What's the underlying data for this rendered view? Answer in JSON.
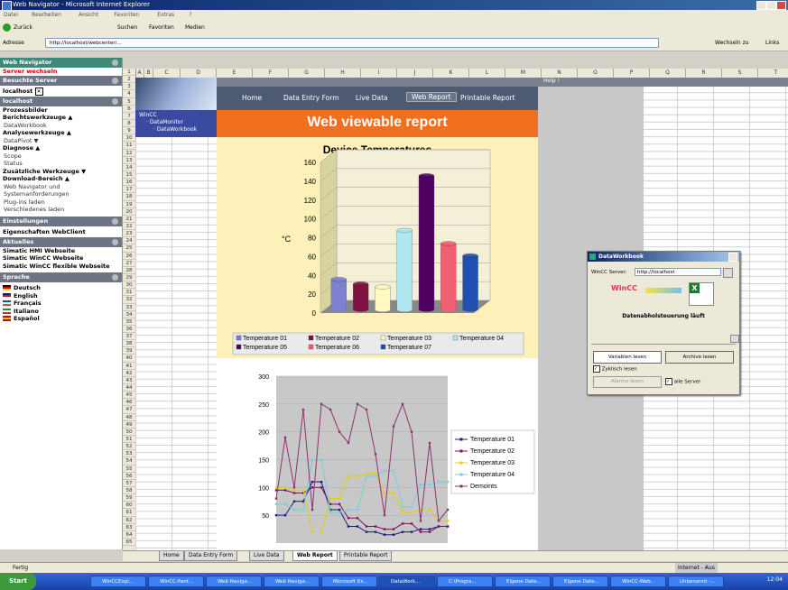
{
  "window": {
    "title": "Web Navigator - Microsoft Internet Explorer"
  },
  "menu": [
    "Datei",
    "Bearbeiten",
    "Ansicht",
    "Favoriten",
    "Extras",
    "?"
  ],
  "toolbar": {
    "back": "Zurück",
    "search": "Suchen",
    "favorites": "Favoriten",
    "media": "Medien"
  },
  "address": {
    "label": "Adresse",
    "url": "http://localhost/webcenter/...",
    "go": "Wechseln zu",
    "links": "Links"
  },
  "sidebar": {
    "title": "Web Navigator",
    "server_switch": "Server wechseln",
    "visited_label": "Besuchte Server",
    "visited_value": "localhost",
    "localhost_label": "localhost",
    "items": [
      {
        "label": "Prozessbilder",
        "bold": true
      },
      {
        "label": "Berichtswerkzeuge ▲",
        "bold": true
      },
      {
        "label": "DataWorkbook",
        "bold": false
      },
      {
        "label": "Analysewerkzeuge ▲",
        "bold": true
      },
      {
        "label": "DataPivot ▼",
        "bold": false
      },
      {
        "label": "Diagnose ▲",
        "bold": true
      },
      {
        "label": "Scope",
        "bold": false
      },
      {
        "label": "Status",
        "bold": false
      },
      {
        "label": "Zusätzliche Werkzeuge ▼",
        "bold": true
      },
      {
        "label": "Download-Bereich ▲",
        "bold": true
      },
      {
        "label": "Web Navigator und",
        "bold": false
      },
      {
        "label": "Systemanforderungen",
        "bold": false
      },
      {
        "label": "Plug-ins laden",
        "bold": false
      },
      {
        "label": "Verschiedenes laden",
        "bold": false
      }
    ],
    "settings_label": "Einstellungen",
    "settings_item": "Eigenschaften WebClient",
    "news_label": "Aktuelles",
    "news_items": [
      "Simatic HMI Webseite",
      "Simatic WinCC Webseite",
      "Simatic WinCC flexible Webseite"
    ],
    "lang_label": "Sprache",
    "languages": [
      {
        "label": "Deutsch",
        "c1": "#000000",
        "c2": "#dd0000",
        "c3": "#ffcc00"
      },
      {
        "label": "English",
        "c1": "#012169",
        "c2": "#c8102e",
        "c3": "#ffffff"
      },
      {
        "label": "Français",
        "c1": "#0055a4",
        "c2": "#ffffff",
        "c3": "#ef4135"
      },
      {
        "label": "Italiano",
        "c1": "#009246",
        "c2": "#ffffff",
        "c3": "#ce2b37"
      },
      {
        "label": "Español",
        "c1": "#aa151b",
        "c2": "#f1bf00",
        "c3": "#aa151b"
      }
    ]
  },
  "sheet": {
    "columns": [
      "A",
      "B",
      "C",
      "D",
      "E",
      "F",
      "G",
      "H",
      "I",
      "J",
      "K",
      "L",
      "M",
      "N",
      "O",
      "P",
      "Q",
      "R",
      "S",
      "T"
    ],
    "nav": [
      "Home",
      "Data Entry Form",
      "Live Data",
      "Web Report",
      "Printable Report"
    ],
    "help": "Help !",
    "wincc_links": [
      "WinCC",
      "DataMonitor",
      "DataWorkbook"
    ],
    "report_title": "Web viewable report",
    "tabs": [
      "Home",
      "Data Entry Form",
      "Live Data",
      "Web Report",
      "Printable Report"
    ]
  },
  "chart_data": [
    {
      "type": "bar",
      "title": "Device Temperatures",
      "ylabel": "°C",
      "ylim": [
        0,
        160
      ],
      "yticks": [
        0,
        20,
        40,
        60,
        80,
        100,
        120,
        140,
        160
      ],
      "categories": [
        "Temperature 01",
        "Temperature 02",
        "Temperature 03",
        "Temperature 04",
        "Temperature 05",
        "Temperature 06",
        "Temperature 07"
      ],
      "values": [
        30,
        25,
        22,
        82,
        140,
        68,
        55
      ],
      "colors": [
        "#8080d0",
        "#801040",
        "#fff8c0",
        "#b0e8f0",
        "#500060",
        "#f06070",
        "#2050b0"
      ],
      "legend": "bottom"
    },
    {
      "type": "line",
      "ylim": [
        0,
        300
      ],
      "yticks": [
        50,
        100,
        150,
        200,
        250,
        300
      ],
      "series": [
        {
          "name": "Temperature 01",
          "color": "#1a1a80",
          "values": [
            50,
            50,
            75,
            75,
            110,
            110,
            60,
            60,
            30,
            30,
            20,
            20,
            15,
            15,
            20,
            20,
            25,
            25,
            30,
            30
          ]
        },
        {
          "name": "Temperature 02",
          "color": "#801060",
          "values": [
            95,
            95,
            90,
            90,
            100,
            100,
            70,
            70,
            45,
            45,
            30,
            30,
            25,
            25,
            35,
            35,
            20,
            20,
            30,
            30
          ]
        },
        {
          "name": "Temperature 03",
          "color": "#e0d000",
          "values": [
            100,
            100,
            95,
            95,
            20,
            20,
            80,
            80,
            120,
            120,
            125,
            125,
            90,
            90,
            55,
            55,
            60,
            60,
            40,
            40
          ]
        },
        {
          "name": "Temperature 04",
          "color": "#70d0e0",
          "values": [
            70,
            70,
            60,
            60,
            150,
            150,
            55,
            55,
            60,
            60,
            120,
            120,
            130,
            130,
            65,
            65,
            105,
            105,
            110,
            110
          ]
        },
        {
          "name": "Demoints",
          "color": "#903070",
          "values": [
            80,
            190,
            100,
            240,
            60,
            250,
            240,
            200,
            180,
            250,
            240,
            160,
            50,
            210,
            250,
            200,
            40,
            180,
            40,
            60
          ]
        }
      ]
    }
  ],
  "dialog": {
    "title": "DataWorkbook",
    "server_label": "WinCC Server:",
    "server_value": "http://localhost",
    "caption": "Datenabholsteuerung läuft",
    "btn_vars": "Variablen lesen",
    "btn_archive": "Archive lesen",
    "cyclic": "Zyklisch lesen",
    "btn_edit": "Alarme lesen",
    "all_servers": "alle Server"
  },
  "status": {
    "left": "Fertig",
    "zone": "Lokales Intranet",
    "zone2": "Internet - Aus",
    "start": "Start"
  },
  "taskbar": {
    "start": "Start",
    "tasks": [
      "WinCCExpl...",
      "WinCC-Pant...",
      "Web Naviga...",
      "Web Naviga...",
      "Microsoft Ex...",
      "DataWork...",
      "C:\\Progra...",
      "Eigene Date...",
      "Eigene Date...",
      "WinCC-Web...",
      "Unbenannt -..."
    ],
    "time": "12:04"
  }
}
